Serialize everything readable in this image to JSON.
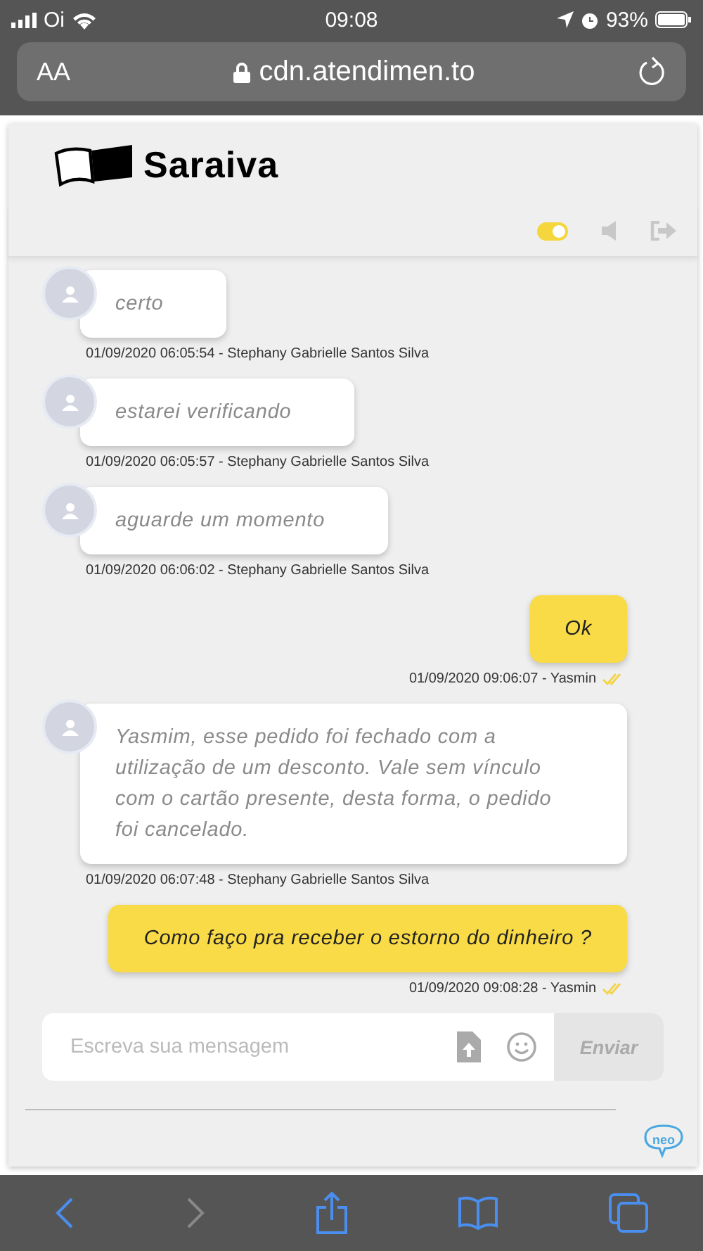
{
  "status_bar": {
    "carrier": "Oi",
    "time": "09:08",
    "battery": "93%"
  },
  "browser": {
    "text_size": "AA",
    "url": "cdn.atendimen.to",
    "back_disabled": false,
    "forward_disabled": true
  },
  "brand": {
    "name": "Saraiva"
  },
  "toolbar": {
    "notifications_on": true
  },
  "messages": [
    {
      "kind": "agent",
      "text": "certo",
      "meta": "01/09/2020 06:05:54 - Stephany Gabrielle Santos Silva"
    },
    {
      "kind": "agent",
      "text": "estarei verificando",
      "meta": "01/09/2020 06:05:57 - Stephany Gabrielle Santos Silva"
    },
    {
      "kind": "agent",
      "text": "aguarde um momento",
      "meta": "01/09/2020 06:06:02 - Stephany Gabrielle Santos Silva"
    },
    {
      "kind": "user",
      "text": "Ok",
      "meta": "01/09/2020 09:06:07 - Yasmin",
      "read": true
    },
    {
      "kind": "agent",
      "text": "Yasmim, esse pedido foi fechado com a utilização de um desconto. Vale sem vínculo com o cartão presente, desta forma, o pedido foi cancelado.",
      "meta": "01/09/2020 06:07:48 - Stephany Gabrielle Santos Silva"
    },
    {
      "kind": "user",
      "text": "Como faço pra receber o estorno do dinheiro ?",
      "meta": "01/09/2020 09:08:28 - Yasmin",
      "read": true
    }
  ],
  "composer": {
    "placeholder": "Escreva sua mensagem",
    "send": "Enviar",
    "send_disabled": true
  },
  "footer": {
    "logo": "neo"
  }
}
